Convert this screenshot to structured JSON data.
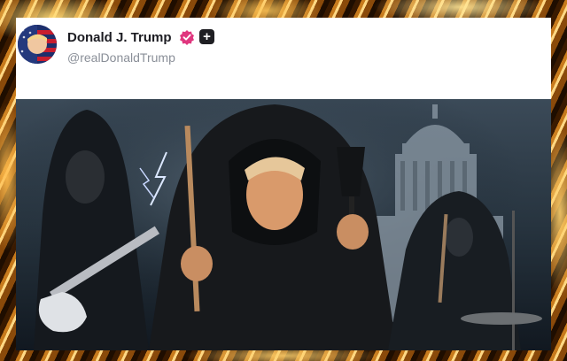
{
  "post": {
    "display_name": "Donald J. Trump",
    "handle": "@realDonaldTrump",
    "verified_icon": "verified-badge-icon",
    "plus_icon": "plus-icon",
    "image_description_icon": "hooded-figures-capitol-image"
  },
  "colors": {
    "frame_gold": "#d08a20",
    "card_bg": "#ffffff",
    "verified_pink": "#e0377f",
    "name_text": "#1c1c22",
    "handle_text": "#8a8f98"
  }
}
